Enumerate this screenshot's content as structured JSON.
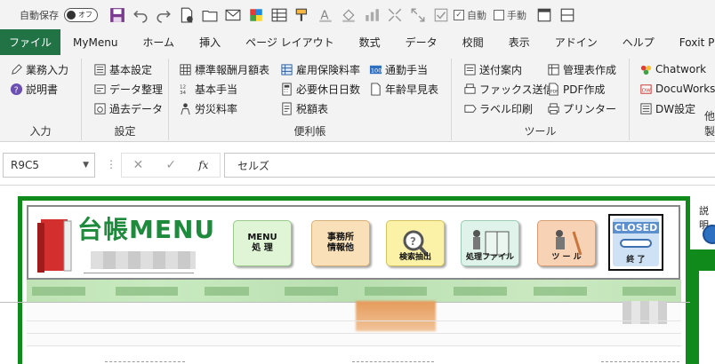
{
  "qat": {
    "autosave_label": "自動保存",
    "toggle_label": "オフ",
    "auto_label": "自動",
    "manual_label": "手動"
  },
  "tabs": [
    "ファイル",
    "MyMenu",
    "ホーム",
    "挿入",
    "ページ レイアウト",
    "数式",
    "データ",
    "校閲",
    "表示",
    "アドイン",
    "ヘルプ",
    "Foxit PDF"
  ],
  "ribbon": {
    "input": {
      "label": "入力",
      "items": [
        "業務入力",
        "説明書"
      ]
    },
    "settings": {
      "label": "設定",
      "items": [
        "基本設定",
        "データ整理",
        "過去データ"
      ]
    },
    "handy": {
      "label": "便利帳",
      "col1": [
        "標準報酬月額表",
        "基本手当",
        "労災料率"
      ],
      "col2": [
        "雇用保険料率",
        "必要休日日数",
        "税額表"
      ],
      "col3": [
        "通勤手当",
        "年齢早見表"
      ]
    },
    "tools": {
      "label": "ツール",
      "col1": [
        "送付案内",
        "ファックス送信",
        "ラベル印刷"
      ],
      "col2": [
        "管理表作成",
        "PDF作成",
        "プリンター"
      ]
    },
    "other": {
      "label": "他社製品",
      "items": [
        "Chatwork",
        "DocuWorks",
        "DW設定"
      ]
    }
  },
  "formula_bar": {
    "name_box": "R9C5",
    "fx": "fx",
    "content": "セルズ"
  },
  "sheet": {
    "logo_title": "台帳MENU",
    "buttons": [
      {
        "line1": "MENU",
        "line2": "処 理",
        "cap": ""
      },
      {
        "line1": "事務所",
        "line2": "情報他",
        "cap": ""
      },
      {
        "line1": "",
        "line2": "",
        "cap": "検索抽出"
      },
      {
        "line1": "",
        "line2": "",
        "cap": "処理ファイル"
      },
      {
        "line1": "",
        "line2": "",
        "cap": "ツ ー ル"
      }
    ],
    "closed": {
      "title": "CLOSED",
      "caption": "終 了"
    },
    "right_label": "説明"
  },
  "colors": {
    "file_tab": "#217346",
    "frame_green": "#118a1c",
    "logo_green": "#1e8a3c"
  }
}
